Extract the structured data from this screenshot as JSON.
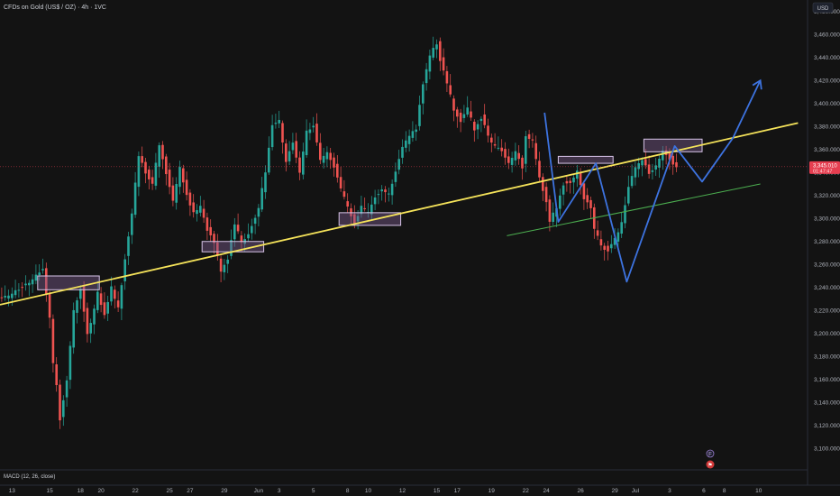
{
  "header": {
    "title": "CFDs on Gold (US$ / OZ) · 4h · 1VC",
    "currency_button": "USD"
  },
  "colors": {
    "background": "#131313",
    "up": "#26a69a",
    "down": "#ef5350",
    "trendline": "#f5e35a",
    "support_line": "#4caf50",
    "projection": "#3d73e0",
    "zone_fill": "#7b5a8c",
    "zone_stroke": "#d7c4e8",
    "price_label": "#e53e50"
  },
  "indicator": {
    "label": "MACD (12, 26, close)"
  },
  "events": {
    "f_badge": "F",
    "flag_badge": "⚑"
  },
  "chart_data": {
    "type": "candlestick",
    "y_axis": {
      "ylim": [
        3090,
        3490
      ],
      "ticks": [
        "3,100.000",
        "3,120.000",
        "3,140.000",
        "3,160.000",
        "3,180.000",
        "3,200.000",
        "3,220.000",
        "3,240.000",
        "3,260.000",
        "3,280.000",
        "3,300.000",
        "3,320.000",
        "3,340.000",
        "3,360.000",
        "3,380.000",
        "3,400.000",
        "3,420.000",
        "3,440.000",
        "3,460.000",
        "3,480.000"
      ],
      "tick_values": [
        3100,
        3120,
        3140,
        3160,
        3180,
        3200,
        3220,
        3240,
        3260,
        3280,
        3300,
        3320,
        3340,
        3360,
        3380,
        3400,
        3420,
        3440,
        3460,
        3480
      ]
    },
    "x_axis": {
      "labels": [
        "13",
        "15",
        "18",
        "20",
        "22",
        "25",
        "27",
        "29",
        "Jun",
        "3",
        "5",
        "8",
        "10",
        "12",
        "15",
        "17",
        "19",
        "22",
        "24",
        "26",
        "29",
        "Jul",
        "3",
        "6",
        "8",
        "10"
      ],
      "label_bars": [
        3,
        14,
        23,
        29,
        39,
        49,
        55,
        65,
        75,
        81,
        91,
        101,
        107,
        117,
        127,
        133,
        143,
        153,
        159,
        169,
        179,
        185,
        195,
        205,
        211,
        221
      ]
    },
    "current_price": {
      "label": "3,345.010",
      "timer": "01:47:47",
      "value": 3345.01
    },
    "path": [
      [
        0,
        3230
      ],
      [
        5,
        3238
      ],
      [
        10,
        3250
      ],
      [
        12,
        3255
      ],
      [
        14,
        3215
      ],
      [
        15,
        3175
      ],
      [
        16,
        3155
      ],
      [
        17,
        3125
      ],
      [
        19,
        3160
      ],
      [
        21,
        3220
      ],
      [
        23,
        3240
      ],
      [
        25,
        3200
      ],
      [
        26,
        3210
      ],
      [
        28,
        3235
      ],
      [
        30,
        3215
      ],
      [
        32,
        3240
      ],
      [
        34,
        3222
      ],
      [
        36,
        3265
      ],
      [
        38,
        3305
      ],
      [
        40,
        3355
      ],
      [
        42,
        3340
      ],
      [
        44,
        3330
      ],
      [
        46,
        3365
      ],
      [
        48,
        3340
      ],
      [
        50,
        3315
      ],
      [
        52,
        3345
      ],
      [
        54,
        3320
      ],
      [
        56,
        3305
      ],
      [
        58,
        3310
      ],
      [
        60,
        3290
      ],
      [
        62,
        3280
      ],
      [
        64,
        3255
      ],
      [
        66,
        3265
      ],
      [
        68,
        3295
      ],
      [
        70,
        3280
      ],
      [
        72,
        3285
      ],
      [
        75,
        3310
      ],
      [
        77,
        3340
      ],
      [
        79,
        3380
      ],
      [
        81,
        3385
      ],
      [
        83,
        3350
      ],
      [
        85,
        3365
      ],
      [
        87,
        3340
      ],
      [
        89,
        3375
      ],
      [
        91,
        3380
      ],
      [
        93,
        3350
      ],
      [
        95,
        3358
      ],
      [
        97,
        3345
      ],
      [
        99,
        3325
      ],
      [
        101,
        3310
      ],
      [
        103,
        3295
      ],
      [
        105,
        3310
      ],
      [
        107,
        3305
      ],
      [
        109,
        3318
      ],
      [
        111,
        3326
      ],
      [
        113,
        3322
      ],
      [
        115,
        3340
      ],
      [
        117,
        3362
      ],
      [
        119,
        3372
      ],
      [
        121,
        3378
      ],
      [
        123,
        3418
      ],
      [
        125,
        3442
      ],
      [
        127,
        3452
      ],
      [
        128,
        3438
      ],
      [
        130,
        3418
      ],
      [
        132,
        3395
      ],
      [
        134,
        3385
      ],
      [
        136,
        3395
      ],
      [
        138,
        3378
      ],
      [
        140,
        3388
      ],
      [
        142,
        3372
      ],
      [
        144,
        3362
      ],
      [
        146,
        3358
      ],
      [
        148,
        3348
      ],
      [
        150,
        3358
      ],
      [
        152,
        3345
      ],
      [
        153,
        3372
      ],
      [
        155,
        3368
      ],
      [
        157,
        3335
      ],
      [
        159,
        3315
      ],
      [
        160,
        3298
      ],
      [
        162,
        3310
      ],
      [
        164,
        3330
      ],
      [
        166,
        3332
      ],
      [
        168,
        3342
      ],
      [
        170,
        3318
      ],
      [
        172,
        3310
      ],
      [
        173,
        3292
      ],
      [
        175,
        3276
      ],
      [
        177,
        3272
      ],
      [
        179,
        3282
      ],
      [
        181,
        3296
      ],
      [
        183,
        3326
      ],
      [
        185,
        3345
      ],
      [
        187,
        3352
      ],
      [
        189,
        3338
      ],
      [
        191,
        3346
      ],
      [
        193,
        3360
      ],
      [
        195,
        3352
      ],
      [
        196,
        3348
      ],
      [
        197,
        3344
      ]
    ],
    "trendline": [
      [
        0,
        3225
      ],
      [
        233,
        3383
      ]
    ],
    "support_line": [
      [
        148,
        3285
      ],
      [
        222,
        3330
      ]
    ],
    "projection": [
      [
        159,
        3392
      ],
      [
        163,
        3297
      ],
      [
        174,
        3348
      ],
      [
        183,
        3245
      ],
      [
        197,
        3363
      ],
      [
        205,
        3332
      ],
      [
        214,
        3370
      ],
      [
        222,
        3420
      ]
    ],
    "zones": [
      {
        "x": [
          11,
          29
        ],
        "y": [
          3238,
          3250
        ]
      },
      {
        "x": [
          59,
          77
        ],
        "y": [
          3271,
          3280
        ]
      },
      {
        "x": [
          99,
          117
        ],
        "y": [
          3294,
          3305
        ]
      },
      {
        "x": [
          163,
          179
        ],
        "y": [
          3348,
          3354
        ]
      },
      {
        "x": [
          188,
          205
        ],
        "y": [
          3358,
          3369
        ]
      }
    ],
    "grid": false
  }
}
